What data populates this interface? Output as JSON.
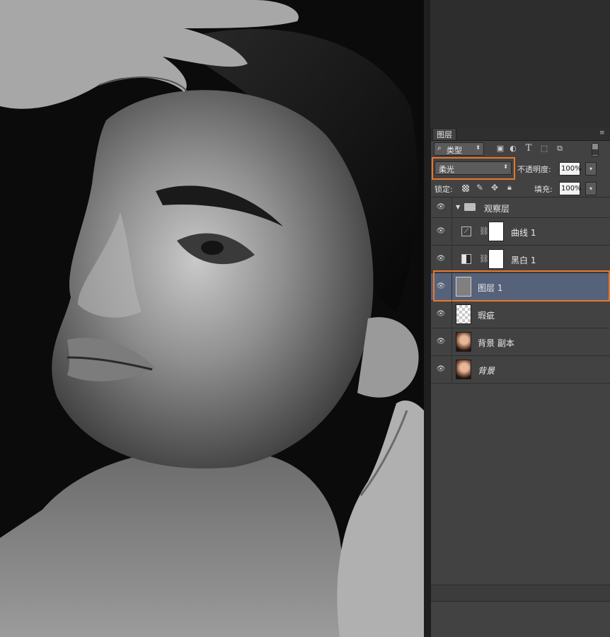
{
  "panel": {
    "tab_label": "图层",
    "filter": {
      "kind_label": "类型",
      "search_icon": "search-icon",
      "icons": [
        "image-filter-icon",
        "adjustment-filter-icon",
        "type-filter-icon",
        "shape-filter-icon",
        "smart-object-filter-icon",
        "filter-toggle-icon"
      ]
    },
    "blend_mode": "柔光",
    "opacity_label": "不透明度:",
    "opacity_value": "100%",
    "lock_label": "锁定:",
    "fill_label": "填充:",
    "fill_value": "100%",
    "highlight_color": "#e8772a",
    "selected_row_color": "#56627a"
  },
  "layers": [
    {
      "name": "观察层",
      "kind": "group",
      "expanded": true
    },
    {
      "name": "曲线 1",
      "kind": "adjustment-curves"
    },
    {
      "name": "黑白 1",
      "kind": "adjustment-bw"
    },
    {
      "name": "图层 1",
      "kind": "layer",
      "selected": true
    },
    {
      "name": "瑕疵",
      "kind": "transparent"
    },
    {
      "name": "背景 副本",
      "kind": "photo"
    },
    {
      "name": "背景",
      "kind": "photo-locked"
    }
  ]
}
